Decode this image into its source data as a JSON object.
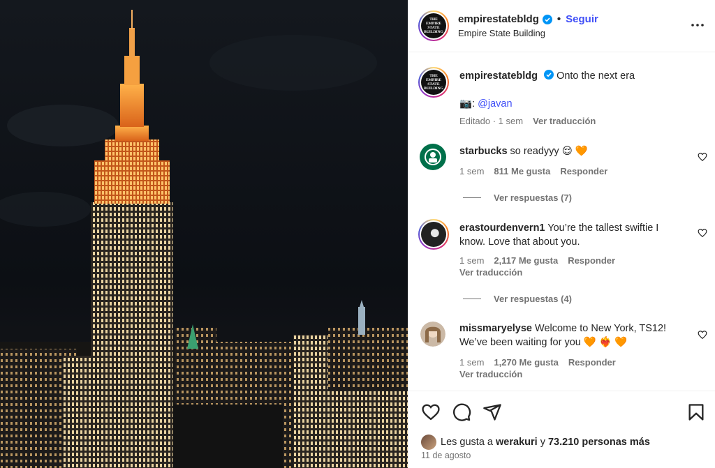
{
  "post": {
    "username": "empirestatebldg",
    "follow_label": "Seguir",
    "location": "Empire State Building",
    "logo_lines": [
      "THE",
      "EMPIRE",
      "STATE",
      "BUILDING"
    ]
  },
  "caption": {
    "username": "empirestatebldg",
    "text": "Onto the next era",
    "credit_prefix": ":",
    "credit_handle": "@javan",
    "edited": "Editado",
    "time": "1 sem",
    "translate": "Ver traducción"
  },
  "comments": [
    {
      "username": "starbucks",
      "text": "so readyyy",
      "emojis": "😌 🧡",
      "time": "1 sem",
      "likes": "811 Me gusta",
      "reply": "Responder",
      "view_replies": "Ver respuestas (7)"
    },
    {
      "username": "erastourdenvern1",
      "text": "You’re the tallest swiftie I know. Love that about you.",
      "time": "1 sem",
      "likes": "2,117 Me gusta",
      "reply": "Responder",
      "translate": "Ver traducción",
      "view_replies": "Ver respuestas (4)"
    },
    {
      "username": "missmaryelyse",
      "text": "Welcome to New York, TS12! We’ve been waiting for you",
      "emojis": "🧡 ❤️‍🔥 🧡",
      "time": "1 sem",
      "likes": "1,270 Me gusta",
      "reply": "Responder",
      "translate": "Ver traducción"
    }
  ],
  "likes_summary": {
    "prefix": "Les gusta a",
    "user": "werakuri",
    "joiner": "y",
    "count_text": "73.210 personas más"
  },
  "post_date": "11 de agosto",
  "colors": {
    "accent": "#4150f7",
    "verified": "#0095f6",
    "muted": "#737373",
    "text": "#262626"
  }
}
